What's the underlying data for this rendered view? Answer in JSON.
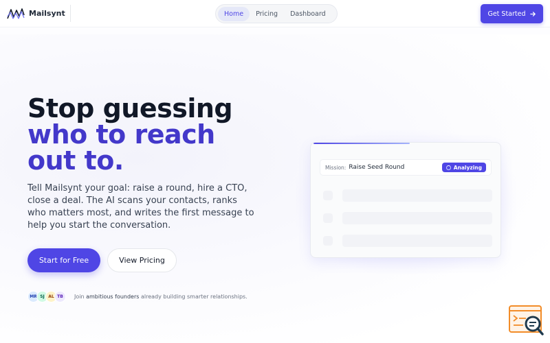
{
  "brand": {
    "name": "Mailsynt"
  },
  "nav": {
    "links": [
      {
        "label": "Home",
        "active": true
      },
      {
        "label": "Pricing",
        "active": false
      },
      {
        "label": "Dashboard",
        "active": false
      }
    ],
    "cta_label": "Get Started",
    "cta_icon": "arrow-right-icon"
  },
  "hero": {
    "title_line1": "Stop guessing",
    "title_line2": "who to reach",
    "title_line3": "out to.",
    "description": "Tell Mailsynt your goal: raise a round, hire a CTO, close a deal. The AI scans your contacts, ranks who matters most, and writes the first message to help you start the conversation.",
    "primary_button": "Start for Free",
    "secondary_button": "View Pricing"
  },
  "social_proof": {
    "avatars": [
      {
        "initials": "MR",
        "bg": "#dbeafe",
        "fg": "#1e40af"
      },
      {
        "initials": "SJ",
        "bg": "#d1fae5",
        "fg": "#065f46"
      },
      {
        "initials": "AL",
        "bg": "#fef3c7",
        "fg": "#92400e"
      },
      {
        "initials": "TB",
        "bg": "#ede9fe",
        "fg": "#5b21b6"
      }
    ],
    "text_prefix": "Join ",
    "text_highlight": "ambitious founders",
    "text_suffix": " already building smarter relationships."
  },
  "preview_card": {
    "mission_label": "Mission:",
    "mission_value": "Raise Seed Round",
    "status_badge": "Analyzing"
  },
  "colors": {
    "accent": "#4f46e5",
    "accent_dark": "#4338ca"
  }
}
